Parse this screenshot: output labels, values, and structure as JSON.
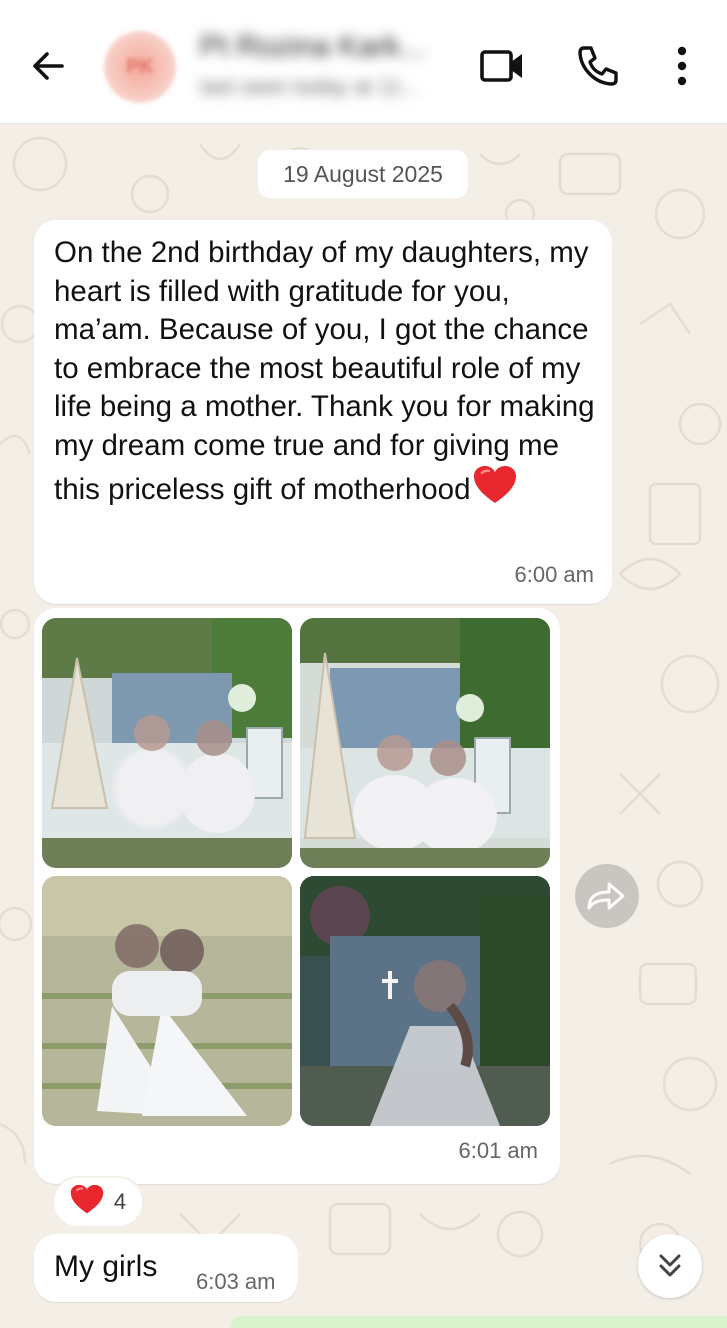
{
  "header": {
    "contact_name": "Pt Rozina Kark...",
    "contact_status": "last seen today at 11...",
    "avatar_initials": "PK",
    "back_icon": "arrow-left-icon",
    "video_icon": "video-camera-icon",
    "call_icon": "phone-icon",
    "menu_icon": "more-vertical-icon"
  },
  "date_chip": "19 August 2025",
  "messages": [
    {
      "text": "On the 2nd birthday of my daughters, my heart is filled with gratitude for you, ma’am. Because of you, I got the chance to embrace the most beautiful role of my life being a mother. Thank you for making my dream come true and for giving me this priceless gift of motherhood",
      "emoji": "red-heart-emoji",
      "time": "6:00 am"
    },
    {
      "type": "photo-album",
      "photos": 4,
      "time": "6:01 am"
    },
    {
      "text": "My girls",
      "time": "6:03 am"
    }
  ],
  "reaction": {
    "emoji": "red-heart-emoji",
    "count": "4"
  },
  "icons": {
    "forward": "forward-icon",
    "scroll_down": "chevrons-down-icon"
  },
  "colors": {
    "wallpaper": "#f3eee6",
    "bubble": "#ffffff",
    "heart": "#e8272f",
    "forward_button": "#c9c6c2"
  }
}
